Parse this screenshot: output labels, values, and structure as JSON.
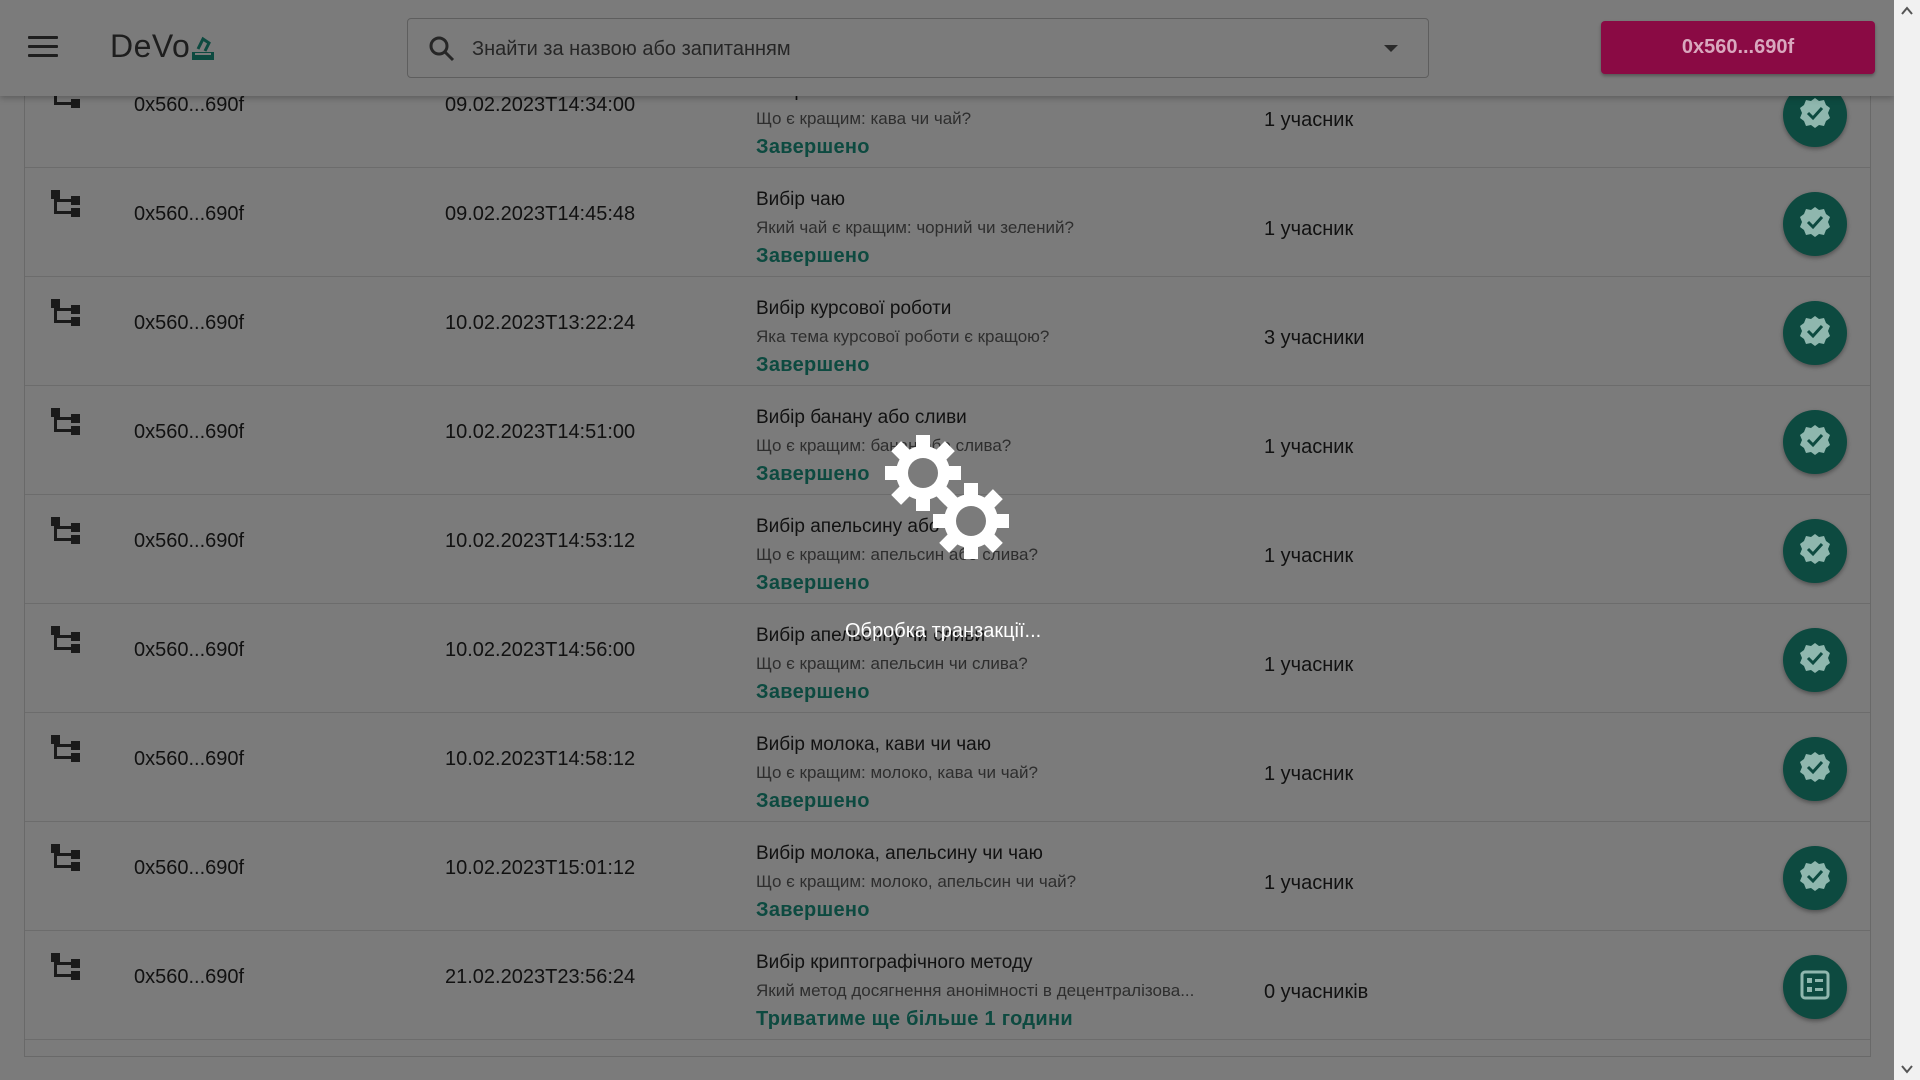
{
  "header": {
    "app_name": "DeVo",
    "search_placeholder": "Знайти за назвою або запитанням",
    "account_label": "0x560...690f"
  },
  "polls": [
    {
      "author": "0x560...690f",
      "date": "09.02.2023T14:34:00",
      "title": "Вибір кави чи чаю",
      "question": "Що є кращим: кава чи чай?",
      "status": "Завершено",
      "participants": "1 учасник",
      "action_icon": "verified-check-icon"
    },
    {
      "author": "0x560...690f",
      "date": "09.02.2023T14:45:48",
      "title": "Вибір чаю",
      "question": "Який чай є кращим: чорний чи зелений?",
      "status": "Завершено",
      "participants": "1 учасник",
      "action_icon": "verified-check-icon"
    },
    {
      "author": "0x560...690f",
      "date": "10.02.2023T13:22:24",
      "title": "Вибір курсової роботи",
      "question": "Яка тема курсової роботи є кращою?",
      "status": "Завершено",
      "participants": "3 учасники",
      "action_icon": "verified-check-icon"
    },
    {
      "author": "0x560...690f",
      "date": "10.02.2023T14:51:00",
      "title": "Вибір банану або сливи",
      "question": "Що є кращим: банан або слива?",
      "status": "Завершено",
      "participants": "1 учасник",
      "action_icon": "verified-check-icon"
    },
    {
      "author": "0x560...690f",
      "date": "10.02.2023T14:53:12",
      "title": "Вибір апельсину або сливи",
      "question": "Що є кращим: апельсин або слива?",
      "status": "Завершено",
      "participants": "1 учасник",
      "action_icon": "verified-check-icon"
    },
    {
      "author": "0x560...690f",
      "date": "10.02.2023T14:56:00",
      "title": "Вибір апельсину чи сливи",
      "question": "Що є кращим: апельсин чи слива?",
      "status": "Завершено",
      "participants": "1 учасник",
      "action_icon": "verified-check-icon"
    },
    {
      "author": "0x560...690f",
      "date": "10.02.2023T14:58:12",
      "title": "Вибір молока, кави чи чаю",
      "question": "Що є кращим: молоко, кава чи чай?",
      "status": "Завершено",
      "participants": "1 учасник",
      "action_icon": "verified-check-icon"
    },
    {
      "author": "0x560...690f",
      "date": "10.02.2023T15:01:12",
      "title": "Вибір молока, апельсину чи чаю",
      "question": "Що є кращим: молоко, апельсин чи чай?",
      "status": "Завершено",
      "participants": "1 учасник",
      "action_icon": "verified-check-icon"
    },
    {
      "author": "0x560...690f",
      "date": "21.02.2023T23:56:24",
      "title": "Вибір криптографічного методу",
      "question": "Який метод досягнення анонімності в децентралізова...",
      "status": "Триватиме ще більше 1 години",
      "participants": "0 учасників",
      "action_icon": "ballot-list-icon"
    }
  ],
  "overlay": {
    "loading_text": "Обробка транзакції..."
  },
  "colors": {
    "accent_green": "#0d4a40",
    "account_button": "#8a0a44",
    "backdrop": "#7b7b7b"
  }
}
